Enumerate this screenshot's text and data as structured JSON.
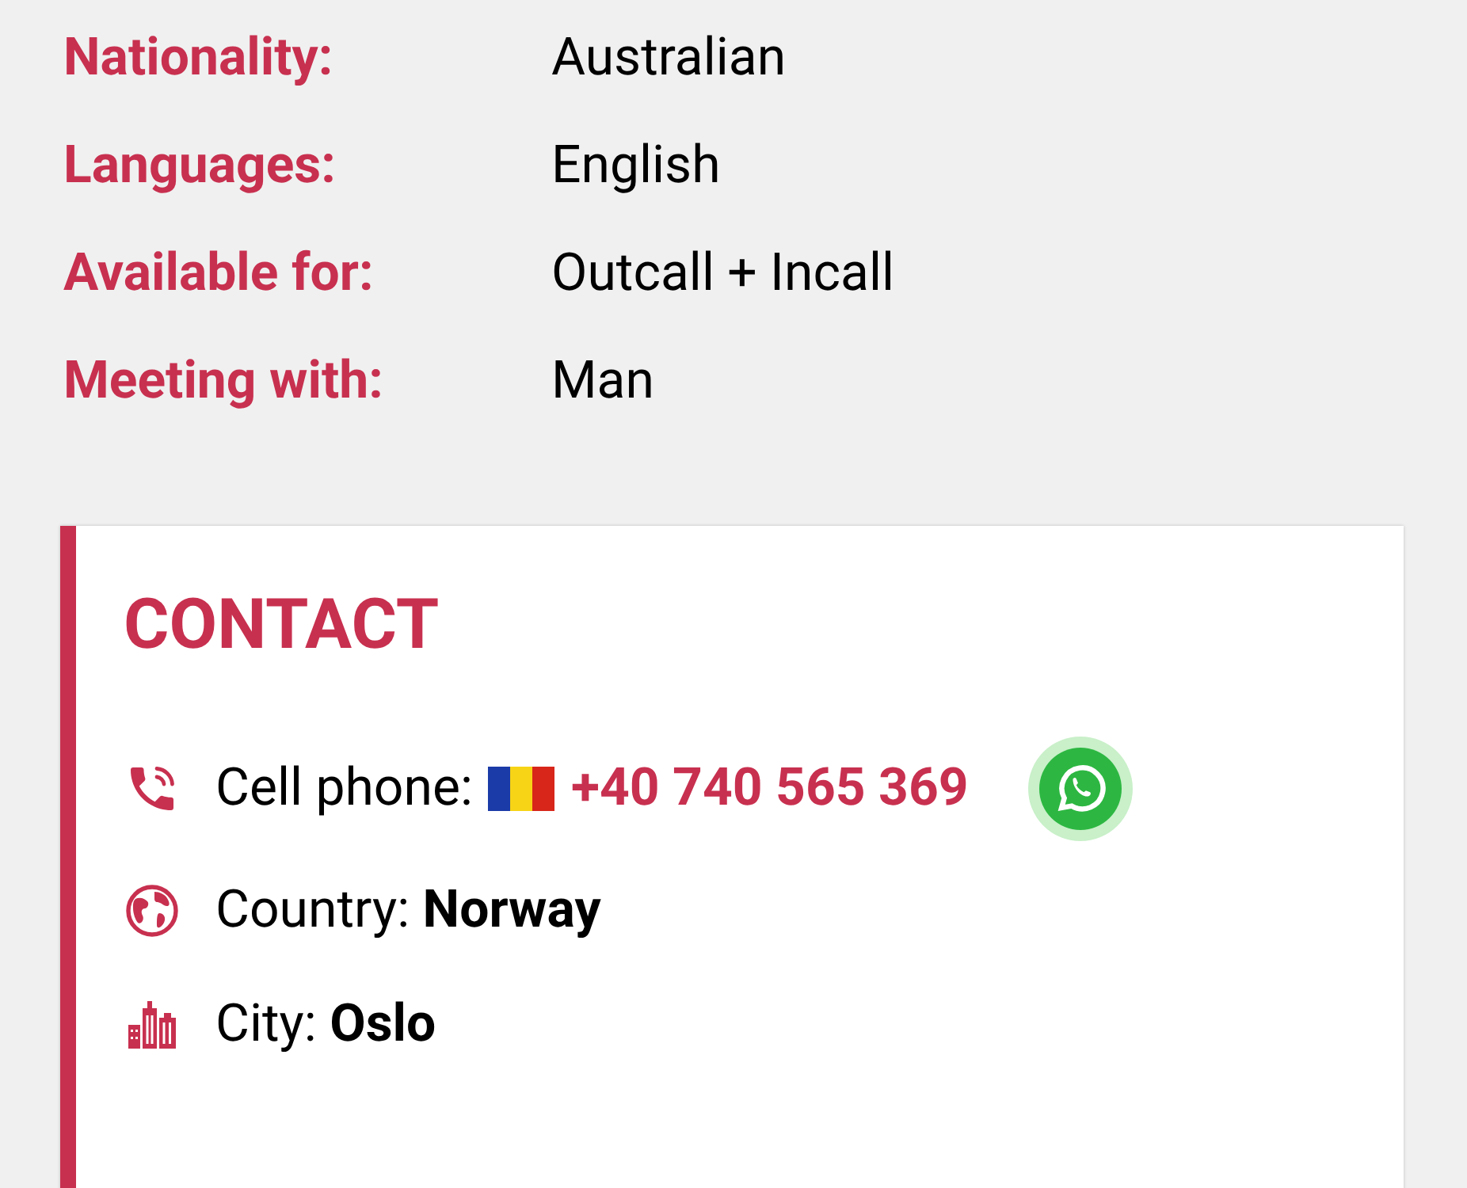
{
  "details": [
    {
      "label": "Nationality:",
      "value": "Australian"
    },
    {
      "label": "Languages:",
      "value": "English"
    },
    {
      "label": "Available for:",
      "value": "Outcall + Incall"
    },
    {
      "label": "Meeting with:",
      "value": "Man"
    }
  ],
  "contact": {
    "title": "CONTACT",
    "items": [
      {
        "kind": "phone",
        "label": "Cell phone:",
        "value": "+40 740 565 369"
      },
      {
        "kind": "country",
        "label": "Country:",
        "value": "Norway"
      },
      {
        "kind": "city",
        "label": "City:",
        "value": "Oslo"
      }
    ]
  }
}
